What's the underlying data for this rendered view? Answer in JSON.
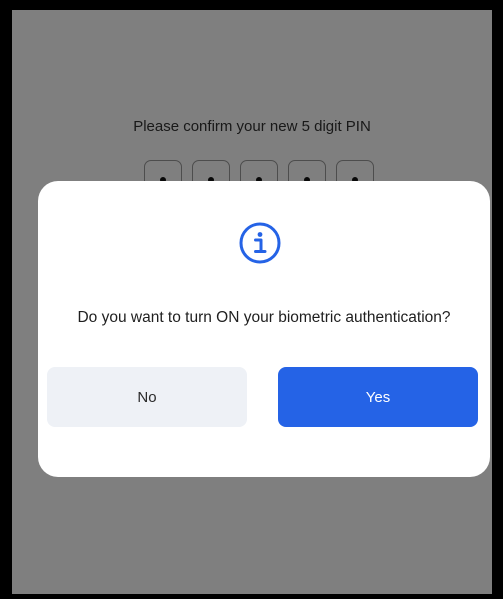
{
  "pin_screen": {
    "prompt": "Please confirm your new 5 digit PIN",
    "pin_length": 5,
    "filled_digits": 5
  },
  "dialog": {
    "icon": "info-circle-icon",
    "question": "Do you want to turn ON your biometric authentication?",
    "no_label": "No",
    "yes_label": "Yes"
  },
  "colors": {
    "accent": "#2563e6",
    "secondary_button_bg": "#eef1f6",
    "overlay": "rgba(0,0,0,0.5)"
  }
}
